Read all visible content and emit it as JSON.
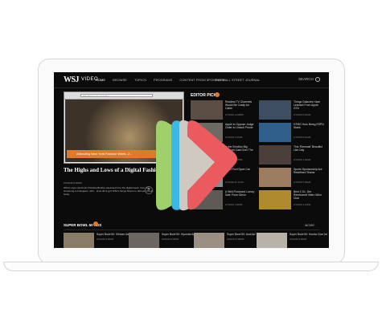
{
  "nav": {
    "logo": "WSJ",
    "logo_sub": "VIDEO",
    "links": [
      "HOME",
      "BROWSE",
      "TOPICS",
      "PROGRAMS",
      "CONTENT FROM SPONSORS"
    ],
    "wsj_link": "THE WALL STREET JOURNAL",
    "search_label": "SEARCH"
  },
  "hero": {
    "url": "http://www.wsj.com/video",
    "banner": "Attending New York Fashion Week, 2...",
    "title": "The Highs and Lows of a Digital Fashion Week",
    "date": "2/7/2016 5:20PM",
    "desc": "WSJ's style columnist Christina Binkley assessed how the digital week, from live-streaming to Instagram, with... How did it go? WSJ's Tanya Rivero to discuss. Photo: Getty",
    "more": "+"
  },
  "picks": {
    "heading": "EDITOR PICKS",
    "count": "",
    "items": [
      {
        "title": "Reddest TV Channels Would Be Costly for Cable",
        "date": "2/7/2016 12:08PM"
      },
      {
        "title": "Things Galaxies Have Learned From Apple GTA",
        "date": "2/7/2016 5:18AM"
      },
      {
        "title": "Apple to Oppose Judge Order to Unlock Phone",
        "date": "2/7/2016 1:37AM"
      },
      {
        "title": "HTMG Hulu Bmsg ESPN Starts",
        "date": "2/7/2016 9:19AM"
      },
      {
        "title": "Is the Emotion Big Enough Cast Over The Music?",
        "date": "2/7/2016 1:47PM"
      },
      {
        "title": "This 'Renewal' Beautiful Like Day",
        "date": "2/7/2016 1:00AM"
      },
      {
        "title": "2016 Ford Sport Car",
        "date": "2/7/2016 11:17AM"
      },
      {
        "title": "Sports Sponsorship Are Redefined Teams",
        "date": "2/7/2016 5:05AM"
      },
      {
        "title": "A Well-Produced Luxury Sale From Glenn",
        "date": "2/7/2016 1:52PM"
      },
      {
        "title": "Best 1 DL: Der Rembrandt Video Wins Club",
        "date": "2/7/2016 1:11PM"
      }
    ]
  },
  "superbowl": {
    "heading": "SUPER BOWL 50 ADS",
    "count": "",
    "more": "MORE",
    "items": [
      {
        "title": "Super Bowl 50: Xfinium Ad",
        "date": "2/6/2016 5:00PM"
      },
      {
        "title": "Super Bowl 50: Hyundai Ad",
        "date": "2/6/2016 5:00PM"
      },
      {
        "title": "Super Bowl 50: Audi Ad",
        "date": "2/6/2016 5:00PM"
      },
      {
        "title": "Super Bowl 50: Honda Clue Ad",
        "date": "2/6/2016 5:00PM"
      }
    ]
  },
  "overlay": {
    "icon": "play-icon",
    "colors": [
      "#9fd06a",
      "#3cb8e6",
      "#cfc9c2",
      "#ea5a5e"
    ]
  }
}
